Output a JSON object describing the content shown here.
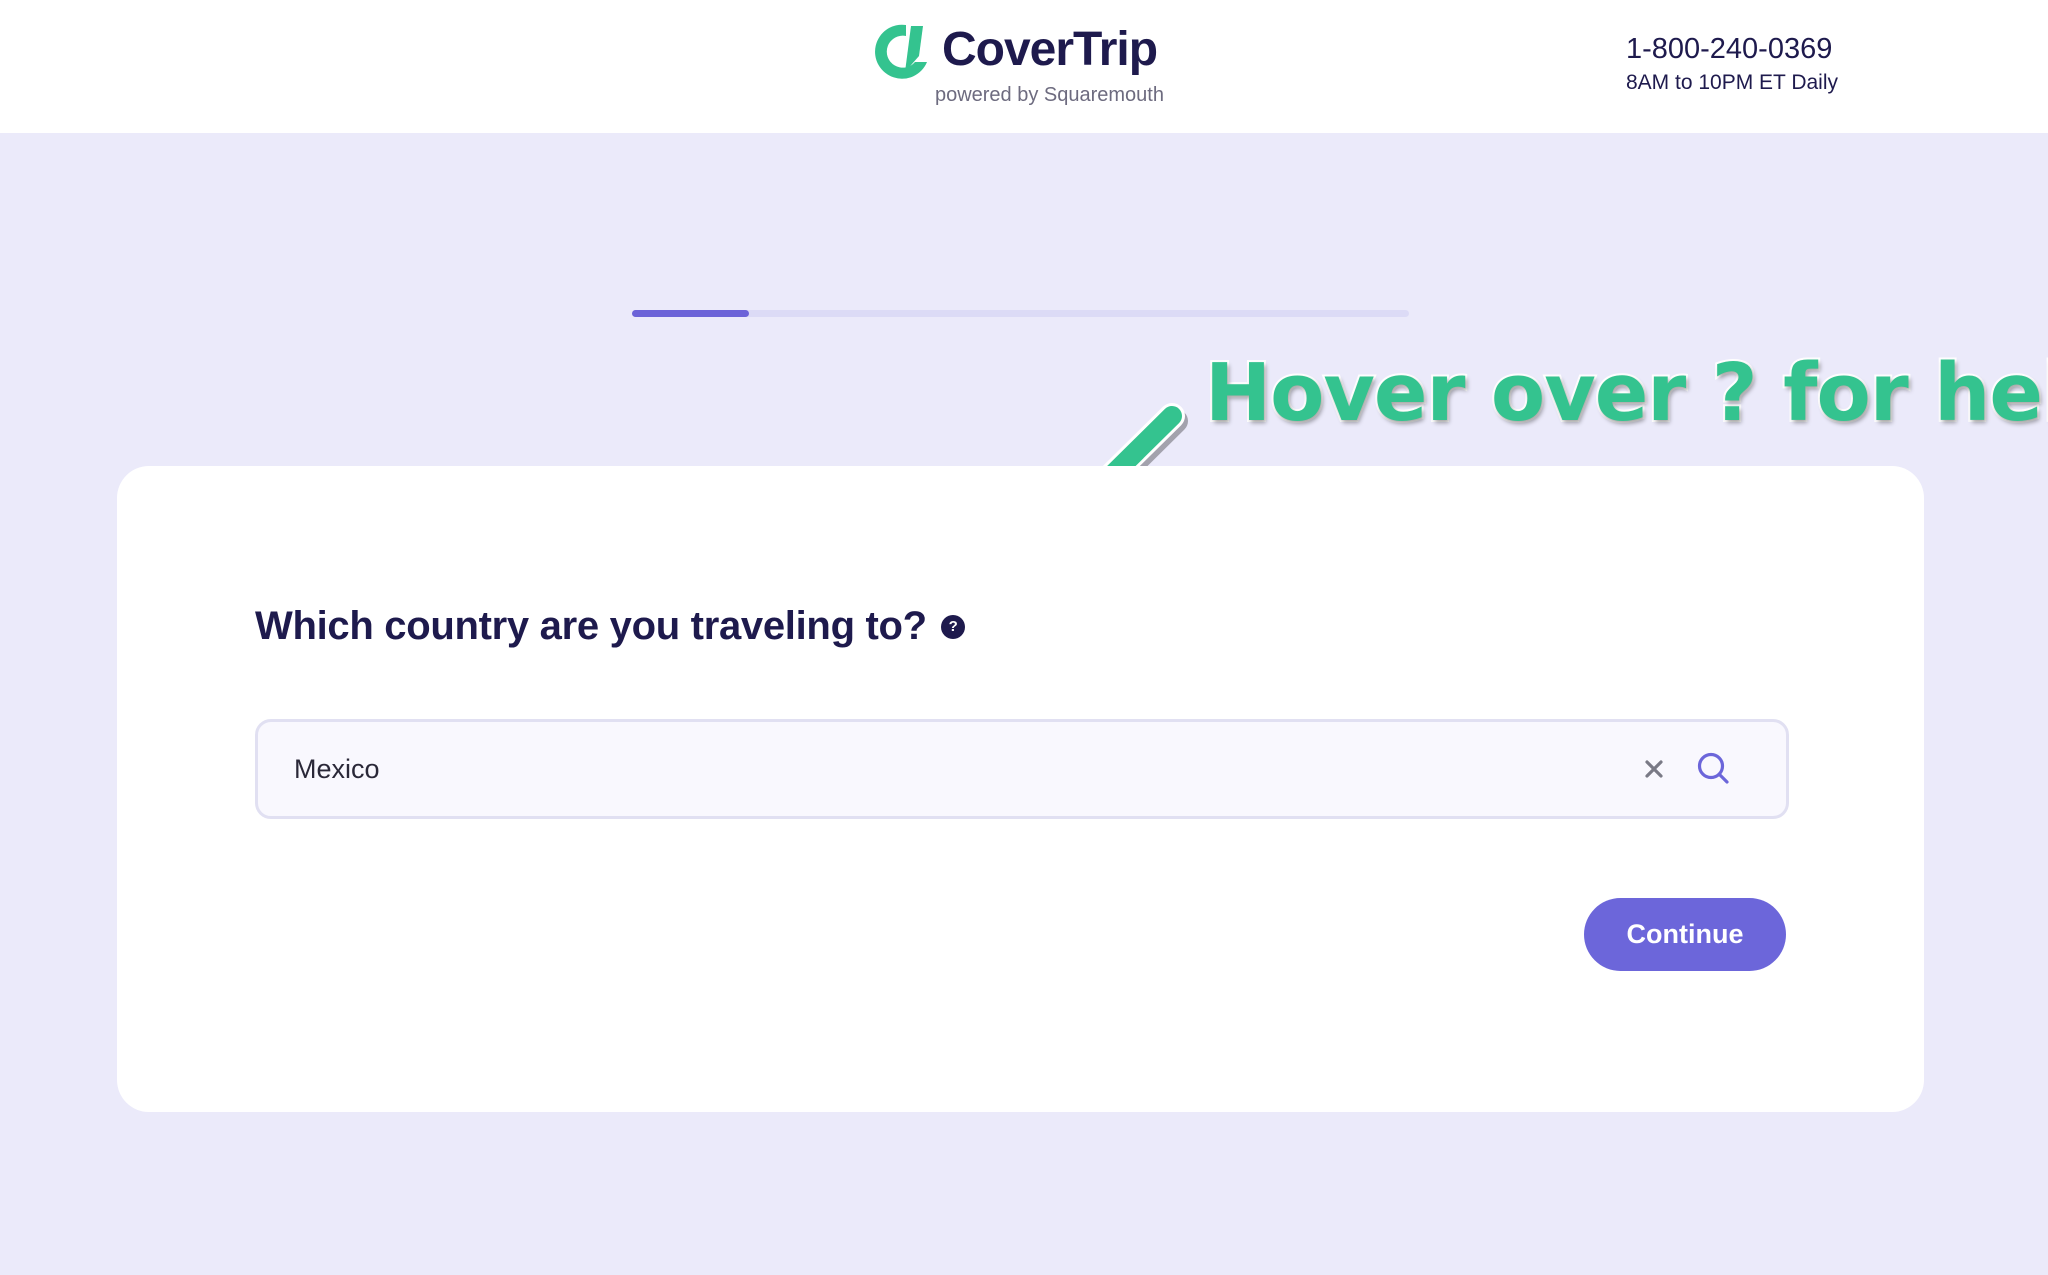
{
  "brand": {
    "name": "CoverTrip",
    "subtitle": "powered by Squaremouth",
    "logo_icon": "covertrip-logo-mark",
    "accent_color": "#34c38f",
    "primary_color": "#6c66da",
    "text_color": "#1e1a4d"
  },
  "contact": {
    "phone": "1-800-240-0369",
    "hours": "8AM to 10PM ET Daily"
  },
  "progress": {
    "fraction": 0.15
  },
  "annotation": {
    "text": "Hover over ? for help",
    "icon": "arrow-pointer-icon"
  },
  "question": {
    "text": "Which country are you traveling to?",
    "help_glyph": "?"
  },
  "search": {
    "value": "Mexico",
    "placeholder": "",
    "clear_icon": "close-icon",
    "search_icon": "search-icon"
  },
  "actions": {
    "continue_label": "Continue"
  }
}
